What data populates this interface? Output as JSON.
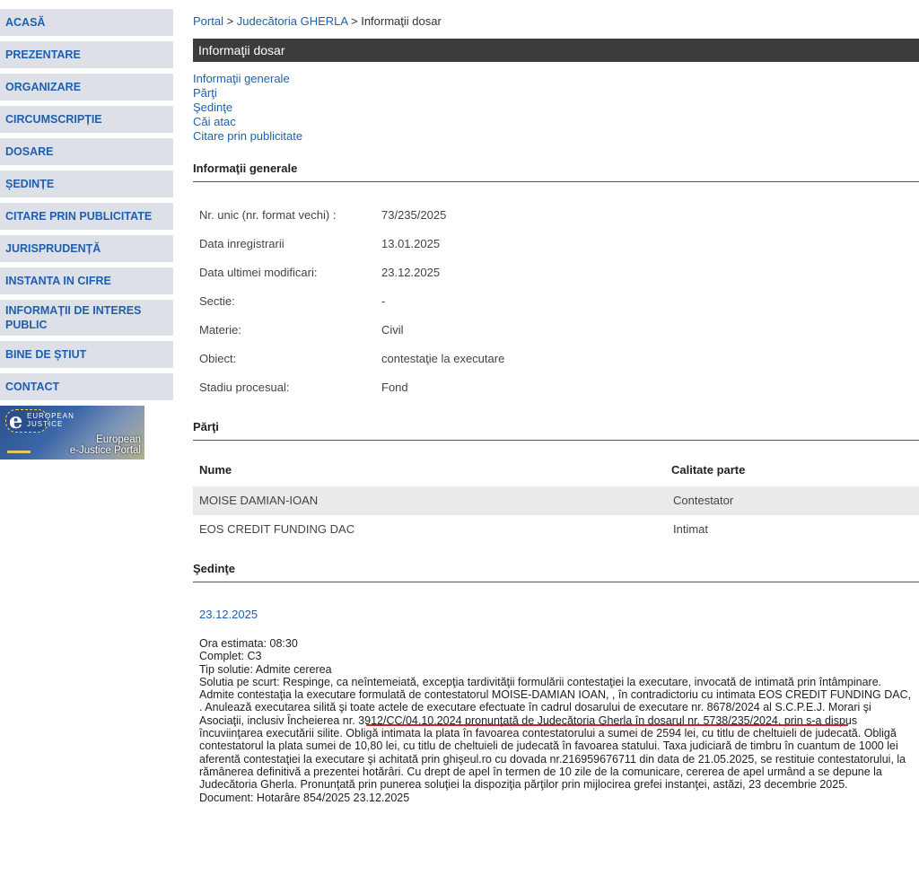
{
  "sidebar": {
    "items": [
      {
        "label": "ACASĂ"
      },
      {
        "label": "PREZENTARE"
      },
      {
        "label": "ORGANIZARE"
      },
      {
        "label": "CIRCUMSCRIPȚIE"
      },
      {
        "label": "DOSARE"
      },
      {
        "label": "ȘEDINȚE"
      },
      {
        "label": "CITARE PRIN PUBLICITATE"
      },
      {
        "label": "JURISPRUDENȚĂ"
      },
      {
        "label": "INSTANTA IN CIFRE"
      },
      {
        "label": "INFORMAȚII DE INTERES PUBLIC"
      },
      {
        "label": "BINE DE ȘTIUT"
      },
      {
        "label": "CONTACT"
      }
    ],
    "ejustice": {
      "logo_letter": "e",
      "logo_text_1": "EUROPEAN",
      "logo_text_2": "JUSTICE",
      "portal_line_1": "European",
      "portal_line_2": "e-Justice Portal"
    }
  },
  "breadcrumb": {
    "portal": "Portal",
    "sep": " > ",
    "court": "Judecătoria GHERLA",
    "current": "Informaţii dosar"
  },
  "title": "Informaţii dosar",
  "anchors": [
    {
      "label": "Informaţii generale"
    },
    {
      "label": "Părţi"
    },
    {
      "label": "Şedinţe"
    },
    {
      "label": "Căi atac"
    },
    {
      "label": "Citare prin publicitate"
    }
  ],
  "general": {
    "heading": "Informaţii generale",
    "rows": [
      {
        "label": "Nr. unic (nr. format vechi) :",
        "value": "73/235/2025"
      },
      {
        "label": "Data inregistrarii",
        "value": "13.01.2025"
      },
      {
        "label": "Data ultimei modificari:",
        "value": "23.12.2025"
      },
      {
        "label": "Sectie:",
        "value": "-"
      },
      {
        "label": "Materie:",
        "value": "Civil"
      },
      {
        "label": "Obiect:",
        "value": "contestaţie la executare"
      },
      {
        "label": "Stadiu procesual:",
        "value": "Fond"
      }
    ]
  },
  "parties": {
    "heading": "Părţi",
    "col_name": "Nume",
    "col_role": "Calitate parte",
    "rows": [
      {
        "name": "MOISE DAMIAN-IOAN",
        "role": "Contestator"
      },
      {
        "name": "EOS CREDIT FUNDING DAC",
        "role": "Intimat"
      }
    ]
  },
  "hearings": {
    "heading": "Şedinţe",
    "date": "23.12.2025",
    "ora": "Ora estimata: 08:30",
    "complet": "Complet: C3",
    "tip": "Tip solutie: Admite cererea",
    "solution": "Solutia pe scurt: Respinge, ca neîntemeiată, excepţia tardivităţii formulării contestaţiei la executare, invocată de intimată prin întâmpinare. Admite contestaţia la executare formulată de contestatorul MOISE-DAMIAN IOAN, , în contradictoriu cu intimata EOS CREDIT FUNDING DAC, . Anulează executarea silită şi toate actele de executare efectuate în cadrul dosarului de executare nr. 8678/2024 al S.C.P.E.J. Morari şi Asociaţii, inclusiv Încheierea nr. 3912/CC/04.10.2024 pronunţată de Judecătoria Gherla în dosarul nr. 5738/235/2024, prin s-a dispus încuviinţarea executării silite. Obligă intimata la plata în favoarea contestatorului a sumei de 2594 lei, cu titlu de cheltuieli de judecată. Obligă contestatorul la plata sumei de 10,80 lei, cu titlu de cheltuieli de judecată în favoarea statului. Taxa judiciară de timbru în cuantum de 1000 lei aferentă contestaţiei la executare şi achitată prin ghişeul.ro cu dovada nr.216959676711 din data de 21.05.2025, se restituie contestatorului, la rămânerea definitivă a prezentei hotărâri. Cu drept de apel în termen de 10 zile de la comunicare, cererea de apel urmând a se depune la Judecătoria Gherla. Pronunţată prin punerea soluţiei la dispoziţia părţilor prin mijlocirea grefei instanţei, astăzi, 23 decembrie 2025.",
    "document": "Document: Hotarâre  854/2025  23.12.2025"
  },
  "colors": {
    "link": "#1f5fb0",
    "nav_bg": "#dde0e6",
    "titlebar_bg": "#3c3c3c",
    "annotation_underline": "#d0222a"
  }
}
